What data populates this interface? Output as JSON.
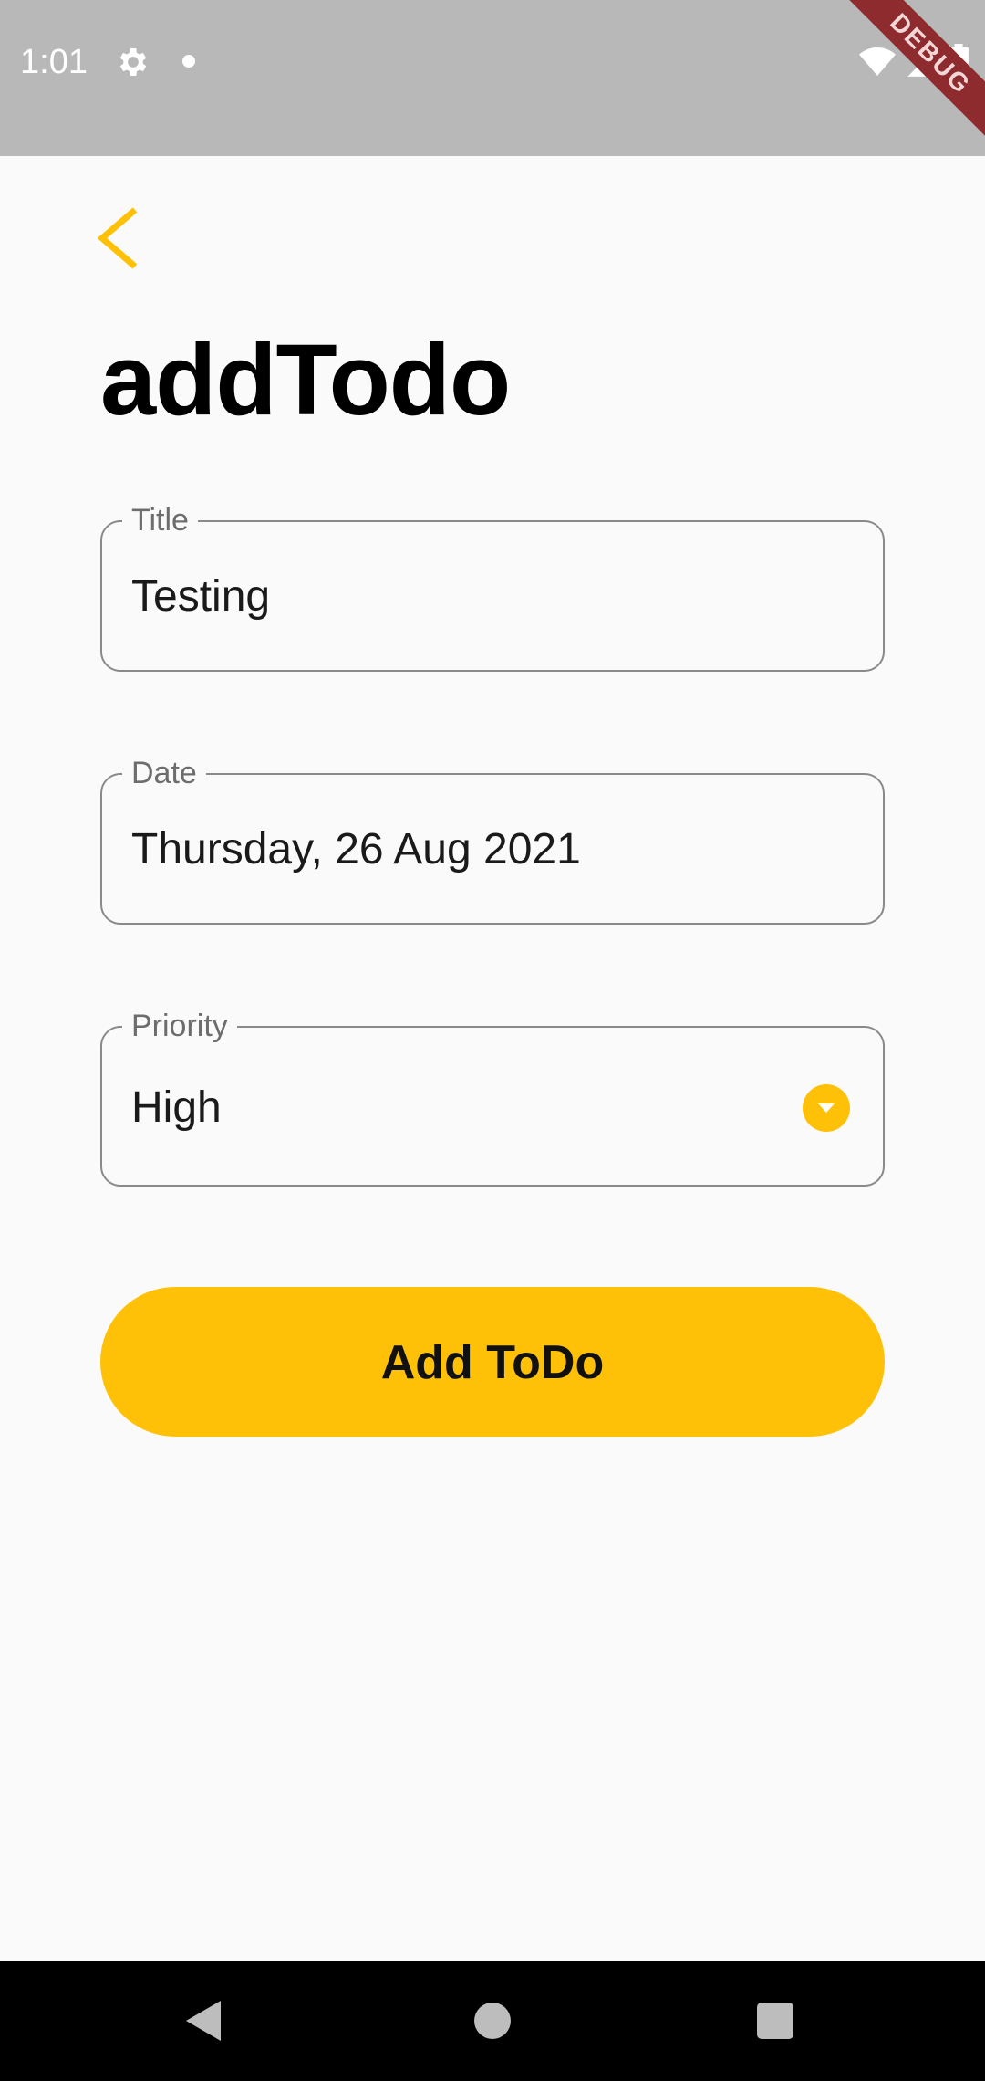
{
  "status_bar": {
    "time": "1:01",
    "icons": [
      "gear-icon",
      "notification-dot-icon",
      "wifi-icon",
      "signal-icon",
      "battery-icon"
    ],
    "debug_banner": "DEBUG",
    "background": "#b8b8b8"
  },
  "header": {
    "back_icon": "chevron-left-icon",
    "title": "addTodo"
  },
  "form": {
    "title_field": {
      "label": "Title",
      "value": "Testing"
    },
    "date_field": {
      "label": "Date",
      "value": "Thursday, 26 Aug 2021"
    },
    "priority_field": {
      "label": "Priority",
      "value": "High",
      "icon": "dropdown-arrow-icon"
    },
    "submit_label": "Add ToDo"
  },
  "nav_bar": {
    "icons": [
      "nav-back-icon",
      "nav-home-icon",
      "nav-recents-icon"
    ]
  },
  "colors": {
    "accent": "#ffc107",
    "background": "#fafafa",
    "field_border": "#8a8a8a",
    "debug_banner": "#8e2b2e"
  }
}
